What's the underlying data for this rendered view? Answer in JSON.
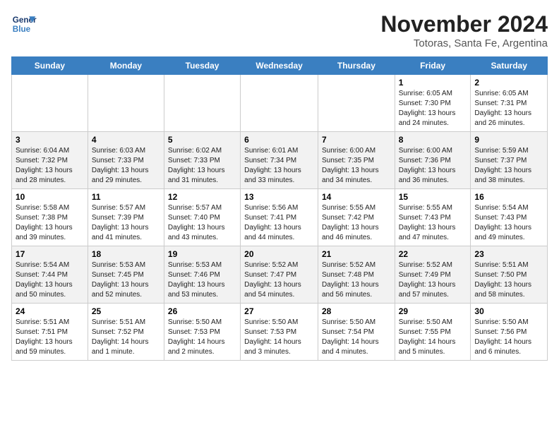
{
  "header": {
    "logo_line1": "General",
    "logo_line2": "Blue",
    "title": "November 2024",
    "subtitle": "Totoras, Santa Fe, Argentina"
  },
  "weekdays": [
    "Sunday",
    "Monday",
    "Tuesday",
    "Wednesday",
    "Thursday",
    "Friday",
    "Saturday"
  ],
  "weeks": [
    [
      {
        "day": "",
        "info": ""
      },
      {
        "day": "",
        "info": ""
      },
      {
        "day": "",
        "info": ""
      },
      {
        "day": "",
        "info": ""
      },
      {
        "day": "",
        "info": ""
      },
      {
        "day": "1",
        "info": "Sunrise: 6:05 AM\nSunset: 7:30 PM\nDaylight: 13 hours\nand 24 minutes."
      },
      {
        "day": "2",
        "info": "Sunrise: 6:05 AM\nSunset: 7:31 PM\nDaylight: 13 hours\nand 26 minutes."
      }
    ],
    [
      {
        "day": "3",
        "info": "Sunrise: 6:04 AM\nSunset: 7:32 PM\nDaylight: 13 hours\nand 28 minutes."
      },
      {
        "day": "4",
        "info": "Sunrise: 6:03 AM\nSunset: 7:33 PM\nDaylight: 13 hours\nand 29 minutes."
      },
      {
        "day": "5",
        "info": "Sunrise: 6:02 AM\nSunset: 7:33 PM\nDaylight: 13 hours\nand 31 minutes."
      },
      {
        "day": "6",
        "info": "Sunrise: 6:01 AM\nSunset: 7:34 PM\nDaylight: 13 hours\nand 33 minutes."
      },
      {
        "day": "7",
        "info": "Sunrise: 6:00 AM\nSunset: 7:35 PM\nDaylight: 13 hours\nand 34 minutes."
      },
      {
        "day": "8",
        "info": "Sunrise: 6:00 AM\nSunset: 7:36 PM\nDaylight: 13 hours\nand 36 minutes."
      },
      {
        "day": "9",
        "info": "Sunrise: 5:59 AM\nSunset: 7:37 PM\nDaylight: 13 hours\nand 38 minutes."
      }
    ],
    [
      {
        "day": "10",
        "info": "Sunrise: 5:58 AM\nSunset: 7:38 PM\nDaylight: 13 hours\nand 39 minutes."
      },
      {
        "day": "11",
        "info": "Sunrise: 5:57 AM\nSunset: 7:39 PM\nDaylight: 13 hours\nand 41 minutes."
      },
      {
        "day": "12",
        "info": "Sunrise: 5:57 AM\nSunset: 7:40 PM\nDaylight: 13 hours\nand 43 minutes."
      },
      {
        "day": "13",
        "info": "Sunrise: 5:56 AM\nSunset: 7:41 PM\nDaylight: 13 hours\nand 44 minutes."
      },
      {
        "day": "14",
        "info": "Sunrise: 5:55 AM\nSunset: 7:42 PM\nDaylight: 13 hours\nand 46 minutes."
      },
      {
        "day": "15",
        "info": "Sunrise: 5:55 AM\nSunset: 7:43 PM\nDaylight: 13 hours\nand 47 minutes."
      },
      {
        "day": "16",
        "info": "Sunrise: 5:54 AM\nSunset: 7:43 PM\nDaylight: 13 hours\nand 49 minutes."
      }
    ],
    [
      {
        "day": "17",
        "info": "Sunrise: 5:54 AM\nSunset: 7:44 PM\nDaylight: 13 hours\nand 50 minutes."
      },
      {
        "day": "18",
        "info": "Sunrise: 5:53 AM\nSunset: 7:45 PM\nDaylight: 13 hours\nand 52 minutes."
      },
      {
        "day": "19",
        "info": "Sunrise: 5:53 AM\nSunset: 7:46 PM\nDaylight: 13 hours\nand 53 minutes."
      },
      {
        "day": "20",
        "info": "Sunrise: 5:52 AM\nSunset: 7:47 PM\nDaylight: 13 hours\nand 54 minutes."
      },
      {
        "day": "21",
        "info": "Sunrise: 5:52 AM\nSunset: 7:48 PM\nDaylight: 13 hours\nand 56 minutes."
      },
      {
        "day": "22",
        "info": "Sunrise: 5:52 AM\nSunset: 7:49 PM\nDaylight: 13 hours\nand 57 minutes."
      },
      {
        "day": "23",
        "info": "Sunrise: 5:51 AM\nSunset: 7:50 PM\nDaylight: 13 hours\nand 58 minutes."
      }
    ],
    [
      {
        "day": "24",
        "info": "Sunrise: 5:51 AM\nSunset: 7:51 PM\nDaylight: 13 hours\nand 59 minutes."
      },
      {
        "day": "25",
        "info": "Sunrise: 5:51 AM\nSunset: 7:52 PM\nDaylight: 14 hours\nand 1 minute."
      },
      {
        "day": "26",
        "info": "Sunrise: 5:50 AM\nSunset: 7:53 PM\nDaylight: 14 hours\nand 2 minutes."
      },
      {
        "day": "27",
        "info": "Sunrise: 5:50 AM\nSunset: 7:53 PM\nDaylight: 14 hours\nand 3 minutes."
      },
      {
        "day": "28",
        "info": "Sunrise: 5:50 AM\nSunset: 7:54 PM\nDaylight: 14 hours\nand 4 minutes."
      },
      {
        "day": "29",
        "info": "Sunrise: 5:50 AM\nSunset: 7:55 PM\nDaylight: 14 hours\nand 5 minutes."
      },
      {
        "day": "30",
        "info": "Sunrise: 5:50 AM\nSunset: 7:56 PM\nDaylight: 14 hours\nand 6 minutes."
      }
    ]
  ]
}
